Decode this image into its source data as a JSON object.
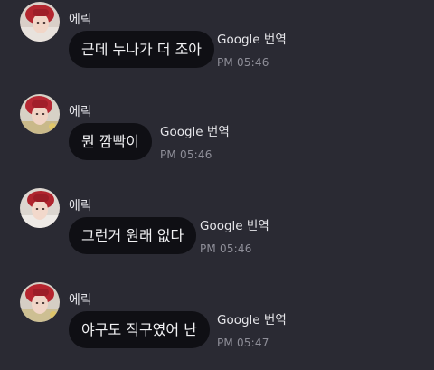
{
  "messages": [
    {
      "sender": "에릭",
      "text": "근데 누나가 더 조아",
      "translated_by": "Google 번역",
      "time": "PM 05:46"
    },
    {
      "sender": "에릭",
      "text": "뭔 깜빡이",
      "translated_by": "Google 번역",
      "time": "PM 05:46"
    },
    {
      "sender": "에릭",
      "text": "그런거 원래 없다",
      "translated_by": "Google 번역",
      "time": "PM 05:46"
    },
    {
      "sender": "에릭",
      "text": "야구도 직구였어 난",
      "translated_by": "Google 번역",
      "time": "PM 05:47"
    }
  ]
}
